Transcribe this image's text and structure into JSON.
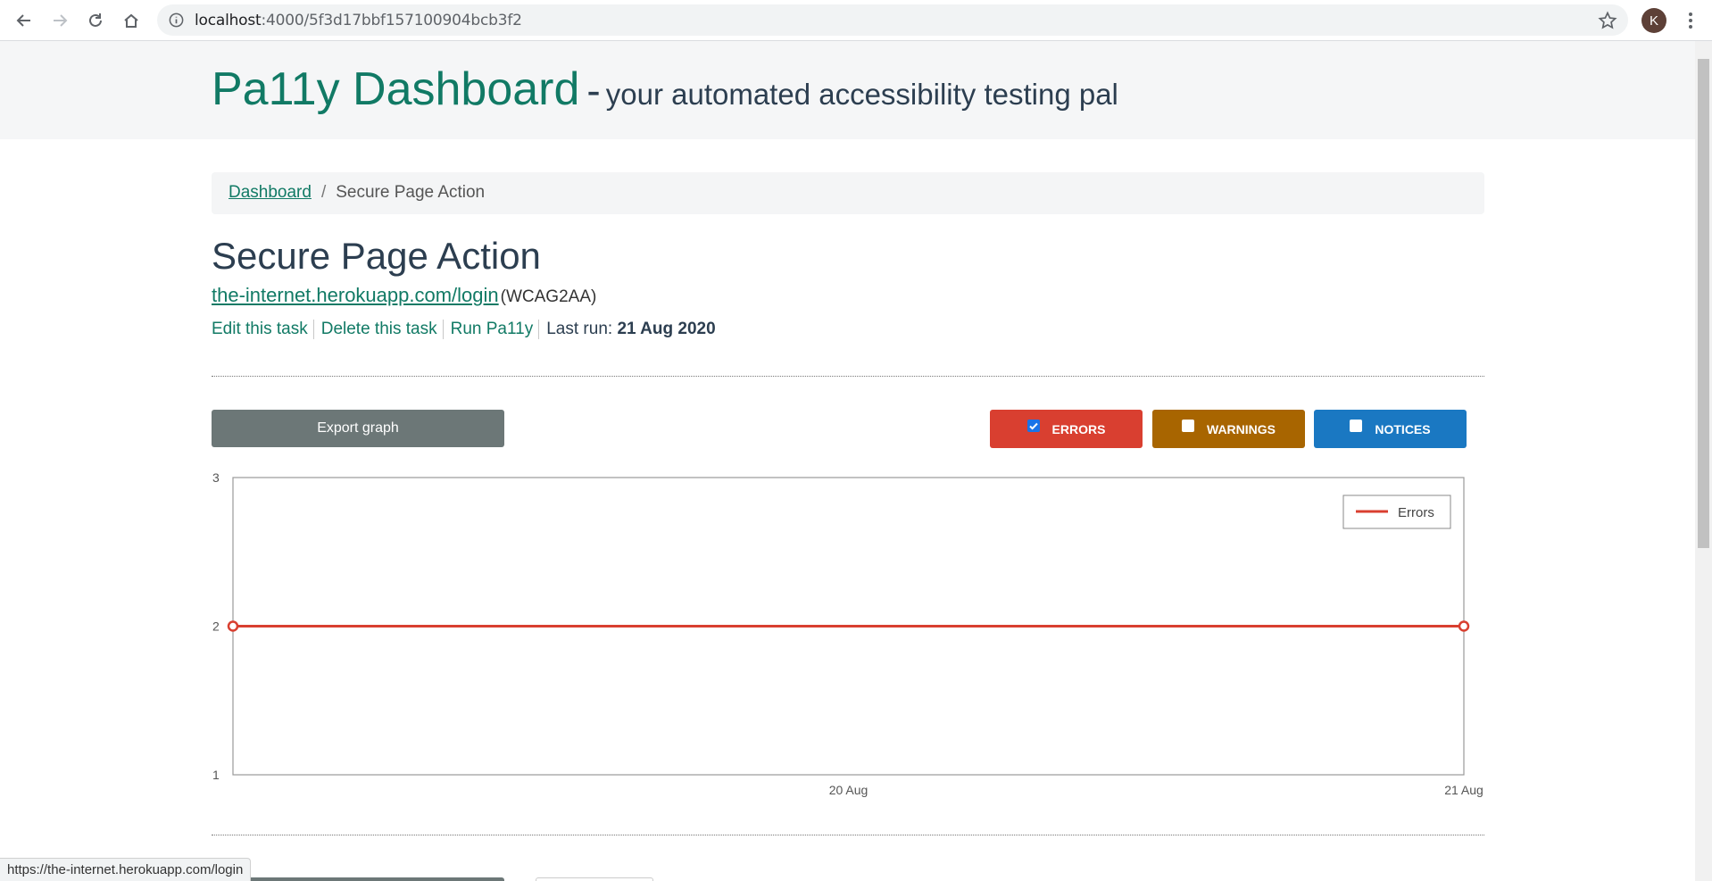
{
  "browser": {
    "url_host": "localhost",
    "url_path": ":4000/5f3d17bbf157100904bcb3f2",
    "avatar_letter": "K",
    "status_url": "https://the-internet.herokuapp.com/login"
  },
  "header": {
    "brand": "Pa11y Dashboard",
    "dash": "-",
    "tagline": "your automated accessibility testing pal"
  },
  "breadcrumb": {
    "home": "Dashboard",
    "separator": "/",
    "current": "Secure Page Action"
  },
  "task": {
    "title": "Secure Page Action",
    "url": "the-internet.herokuapp.com/login",
    "standard": "(WCAG2AA)",
    "actions": {
      "edit": "Edit this task",
      "delete": "Delete this task",
      "run": "Run Pa11y"
    },
    "last_run_label": "Last run:",
    "last_run_date": "21 Aug 2020"
  },
  "graph_controls": {
    "export_label": "Export graph",
    "errors": {
      "label": "ERRORS",
      "checked": true,
      "color": "#d93f30"
    },
    "warnings": {
      "label": "WARNINGS",
      "checked": false,
      "color": "#a86500"
    },
    "notices": {
      "label": "NOTICES",
      "checked": false,
      "color": "#1a78c2"
    }
  },
  "chart_data": {
    "type": "line",
    "title": "",
    "xlabel": "",
    "ylabel": "",
    "ylim": [
      1,
      3
    ],
    "yticks": [
      "1",
      "2",
      "3"
    ],
    "xticks": [
      "20 Aug",
      "21 Aug"
    ],
    "legend_position": "top-right",
    "grid": false,
    "series": [
      {
        "name": "Errors",
        "color": "#d93f30",
        "points": [
          {
            "x": "19 Aug 2020",
            "y": 2
          },
          {
            "x": "21 Aug 2020",
            "y": 2
          }
        ]
      }
    ]
  }
}
